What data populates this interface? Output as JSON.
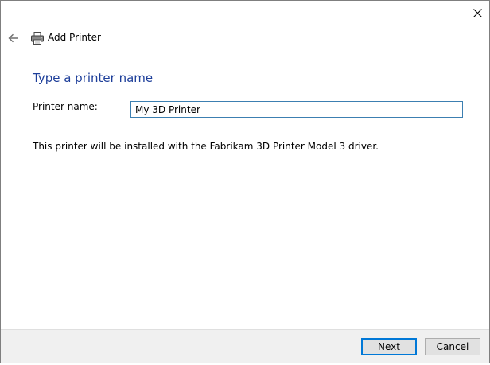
{
  "window": {
    "title": "Add Printer",
    "close_icon": "close-icon",
    "back_icon": "back-arrow-icon",
    "title_icon": "printer-icon"
  },
  "page": {
    "heading": "Type a printer name",
    "printer_name_label": "Printer name:",
    "printer_name_value": "My 3D Printer",
    "info": "This printer will be installed with the Fabrikam 3D Printer Model 3 driver."
  },
  "footer": {
    "next_label": "Next",
    "cancel_label": "Cancel"
  },
  "colors": {
    "heading": "#1e3f9a",
    "input_border": "#3c7fb1",
    "default_button_border": "#0078d7",
    "footer_bg": "#f0f0f0"
  }
}
